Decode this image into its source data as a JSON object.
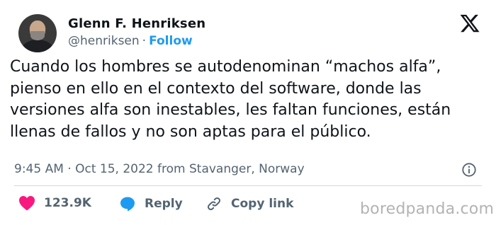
{
  "author": {
    "name": "Glenn F. Henriksen",
    "handle": "@henriksen",
    "separator": "·",
    "follow_label": "Follow"
  },
  "tweet": {
    "text": "Cuando los hombres se autodenominan “machos alfa”,\npienso en ello en el contexto del software, donde  las\nversiones alfa son inestables, les faltan funciones, están\nllenas de fallos y no son aptas para el público.",
    "time": "9:45 AM",
    "date": "Oct 15, 2022",
    "source": "from Stavanger, Norway",
    "meta_separator": "·"
  },
  "actions": {
    "like_count": "123.9K",
    "reply_label": "Reply",
    "copy_link_label": "Copy link"
  },
  "icons": {
    "logo": "x-logo-icon",
    "info": "info-icon",
    "like": "heart-icon",
    "reply": "speech-bubble-icon",
    "copy": "link-icon"
  },
  "colors": {
    "accent": "#1d9bf0",
    "like": "#f91880",
    "reply": "#1d9bf0",
    "text": "#0f1419",
    "secondary": "#536471"
  },
  "watermark": "boredpanda.com"
}
